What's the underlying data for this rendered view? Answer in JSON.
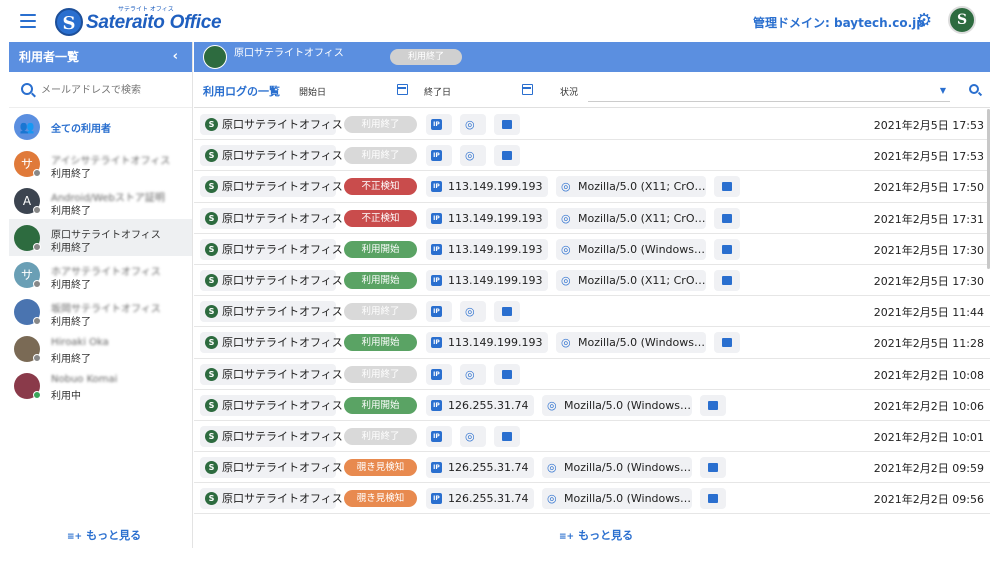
{
  "header": {
    "logo_text": "Sateraito Office",
    "logo_sub": "サテライト オフィス",
    "domain_label": "管理ドメイン: baytech.co.jp"
  },
  "left_panel": {
    "title": "利用者一覧",
    "search_placeholder": "メールアドレスで検索",
    "all_users_label": "全ての利用者",
    "users": [
      {
        "initial": "サ",
        "name": "アイシサテライトオフィス",
        "status": "利用終了",
        "color": "#e07a3a",
        "online": false
      },
      {
        "initial": "A",
        "name": "Android/Webストア証明",
        "status": "利用終了",
        "color": "#3c4450",
        "online": false
      },
      {
        "initial": "",
        "name": "原口サテライトオフィス",
        "status": "利用終了",
        "color": "#2d6b3f",
        "online": false
      },
      {
        "initial": "サ",
        "name": "ホアサテライトオフィス",
        "status": "利用終了",
        "color": "#6a9fb5",
        "online": false
      },
      {
        "initial": "",
        "name": "坂岡サテライトオフィス",
        "status": "利用終了",
        "color": "#4a74b0",
        "online": false
      },
      {
        "initial": "",
        "name": "Hiroaki Oka",
        "status": "利用終了",
        "color": "#7a6a55",
        "online": false
      },
      {
        "initial": "",
        "name": "Nobuo Komai",
        "status": "利用中",
        "color": "#8a3a4a",
        "online": true
      }
    ],
    "more_label": "もっと見る"
  },
  "right_panel": {
    "selected_user": "原口サテライトオフィス",
    "selected_status": "利用終了",
    "log_title": "利用ログの一覧",
    "start_label": "開始日",
    "end_label": "終了日",
    "status_label": "状況",
    "more_label": "もっと見る",
    "logs": [
      {
        "name": "原口サテライトオフィス",
        "status": "利用終了",
        "kind": "end",
        "ip": "",
        "ua": "",
        "time": "2021年2月5日 17:53"
      },
      {
        "name": "原口サテライトオフィス",
        "status": "利用終了",
        "kind": "end",
        "ip": "",
        "ua": "",
        "time": "2021年2月5日 17:53"
      },
      {
        "name": "原口サテライトオフィス",
        "status": "不正検知",
        "kind": "fraud",
        "ip": "113.149.199.193",
        "ua": "Mozilla/5.0 (X11; CrO…",
        "time": "2021年2月5日 17:50"
      },
      {
        "name": "原口サテライトオフィス",
        "status": "不正検知",
        "kind": "fraud",
        "ip": "113.149.199.193",
        "ua": "Mozilla/5.0 (X11; CrO…",
        "time": "2021年2月5日 17:31"
      },
      {
        "name": "原口サテライトオフィス",
        "status": "利用開始",
        "kind": "start",
        "ip": "113.149.199.193",
        "ua": "Mozilla/5.0 (Windows…",
        "time": "2021年2月5日 17:30"
      },
      {
        "name": "原口サテライトオフィス",
        "status": "利用開始",
        "kind": "start",
        "ip": "113.149.199.193",
        "ua": "Mozilla/5.0 (X11; CrO…",
        "time": "2021年2月5日 17:30"
      },
      {
        "name": "原口サテライトオフィス",
        "status": "利用終了",
        "kind": "end",
        "ip": "",
        "ua": "",
        "time": "2021年2月5日 11:44"
      },
      {
        "name": "原口サテライトオフィス",
        "status": "利用開始",
        "kind": "start",
        "ip": "113.149.199.193",
        "ua": "Mozilla/5.0 (Windows…",
        "time": "2021年2月5日 11:28"
      },
      {
        "name": "原口サテライトオフィス",
        "status": "利用終了",
        "kind": "end",
        "ip": "",
        "ua": "",
        "time": "2021年2月2日 10:08"
      },
      {
        "name": "原口サテライトオフィス",
        "status": "利用開始",
        "kind": "start",
        "ip": "126.255.31.74",
        "ua": "Mozilla/5.0 (Windows…",
        "time": "2021年2月2日 10:06"
      },
      {
        "name": "原口サテライトオフィス",
        "status": "利用終了",
        "kind": "end",
        "ip": "",
        "ua": "",
        "time": "2021年2月2日 10:01"
      },
      {
        "name": "原口サテライトオフィス",
        "status": "覗き見検知",
        "kind": "peek",
        "ip": "126.255.31.74",
        "ua": "Mozilla/5.0 (Windows…",
        "time": "2021年2月2日 09:59"
      },
      {
        "name": "原口サテライトオフィス",
        "status": "覗き見検知",
        "kind": "peek",
        "ip": "126.255.31.74",
        "ua": "Mozilla/5.0 (Windows…",
        "time": "2021年2月2日 09:56"
      }
    ]
  }
}
